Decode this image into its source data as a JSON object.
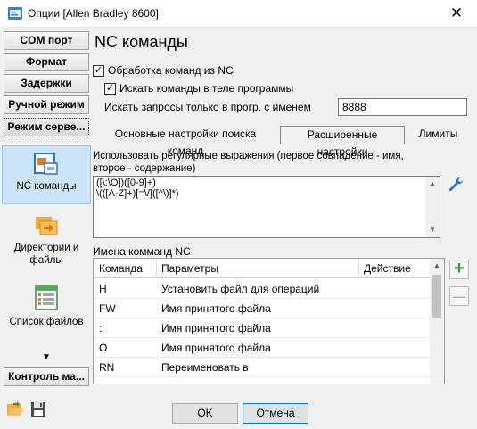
{
  "window": {
    "title": "Опции [Allen Bradley 8600]",
    "close_glyph": "✕"
  },
  "sidebar": {
    "buttons": [
      {
        "label": "COM порт"
      },
      {
        "label": "Формат"
      },
      {
        "label": "Задержки"
      },
      {
        "label": "Ручной режим"
      },
      {
        "label": "Режим серве..."
      }
    ],
    "panel_items": [
      {
        "label": "NC команды",
        "icon": "nc-commands-icon"
      },
      {
        "label": "Директории и файлы",
        "icon": "folders-icon"
      },
      {
        "label": "Список файлов",
        "icon": "file-list-icon"
      }
    ],
    "arrow": "▼",
    "bottom_button": "Контроль ма..."
  },
  "main": {
    "title": "NC команды",
    "process_nc": {
      "label": "Обработка команд из NC",
      "checked": true
    },
    "search_in_body": {
      "label": "Искать команды в теле программы",
      "checked": true
    },
    "search_requests_label": "Искать запросы только в прогр. с именем",
    "search_requests_value": "8888",
    "tabs": [
      {
        "label": "Основные настройки поиска команд"
      },
      {
        "label": "Расширенные настройки"
      },
      {
        "label": "Лимиты"
      }
    ],
    "regex_label": "Использовать регулярные выражения (первое совпадение - имя, второе - содержание)",
    "regex_lines": [
      "([\\:\\O])([0-9]+)",
      "\\(([A-Z]+)[=\\/]([^\\)]*)"
    ],
    "names_label": "Имена комманд NC",
    "grid": {
      "columns": [
        "Команда",
        "Параметры",
        "Действие"
      ],
      "rows": [
        {
          "cmd": "H",
          "param": "Установить файл для операций",
          "action": ""
        },
        {
          "cmd": "FW",
          "param": "Имя принятого файла",
          "action": ""
        },
        {
          "cmd": ":",
          "param": "Имя принятого файла",
          "action": ""
        },
        {
          "cmd": "O",
          "param": "Имя принятого файла",
          "action": ""
        },
        {
          "cmd": "RN",
          "param": "Переименовать в",
          "action": ""
        }
      ]
    },
    "add_glyph": "+",
    "remove_glyph": "—"
  },
  "footer": {
    "ok": "OK",
    "cancel": "Отмена"
  },
  "colors": {
    "accent": "#0078d7",
    "selection": "#cce4f7",
    "add_green": "#2e9b2e"
  }
}
